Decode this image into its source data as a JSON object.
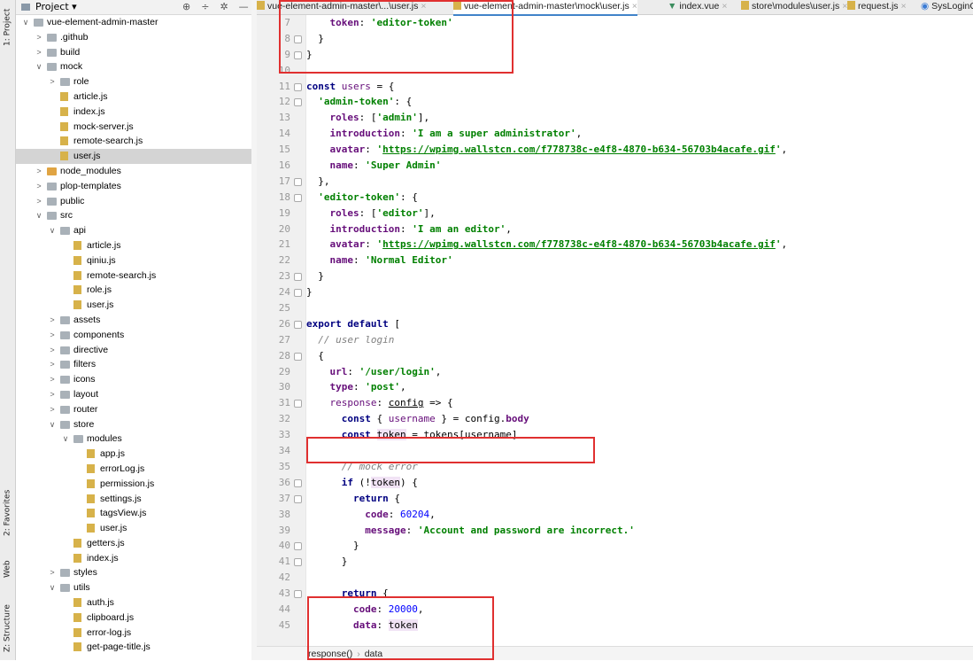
{
  "strip": {
    "project": "1: Project",
    "favorites": "2: Favorites",
    "web": "Web",
    "structure": "Z: Structure"
  },
  "project_header": {
    "label": "Project ▾",
    "tools": [
      "⊕",
      "÷",
      "✲",
      "—"
    ]
  },
  "tree": [
    {
      "depth": 0,
      "arrow": "∨",
      "type": "folder",
      "label": "vue-element-admin-master"
    },
    {
      "depth": 1,
      "arrow": ">",
      "type": "folder",
      "label": ".github"
    },
    {
      "depth": 1,
      "arrow": ">",
      "type": "folder",
      "label": "build"
    },
    {
      "depth": 1,
      "arrow": "∨",
      "type": "folder",
      "label": "mock"
    },
    {
      "depth": 2,
      "arrow": ">",
      "type": "folder",
      "label": "role"
    },
    {
      "depth": 2,
      "arrow": "",
      "type": "js",
      "label": "article.js"
    },
    {
      "depth": 2,
      "arrow": "",
      "type": "js",
      "label": "index.js"
    },
    {
      "depth": 2,
      "arrow": "",
      "type": "js",
      "label": "mock-server.js"
    },
    {
      "depth": 2,
      "arrow": "",
      "type": "js",
      "label": "remote-search.js"
    },
    {
      "depth": 2,
      "arrow": "",
      "type": "js",
      "label": "user.js",
      "selected": true
    },
    {
      "depth": 1,
      "arrow": ">",
      "type": "folder-orange",
      "label": "node_modules"
    },
    {
      "depth": 1,
      "arrow": ">",
      "type": "folder",
      "label": "plop-templates"
    },
    {
      "depth": 1,
      "arrow": ">",
      "type": "folder",
      "label": "public"
    },
    {
      "depth": 1,
      "arrow": "∨",
      "type": "folder",
      "label": "src"
    },
    {
      "depth": 2,
      "arrow": "∨",
      "type": "folder",
      "label": "api"
    },
    {
      "depth": 3,
      "arrow": "",
      "type": "js",
      "label": "article.js"
    },
    {
      "depth": 3,
      "arrow": "",
      "type": "js",
      "label": "qiniu.js"
    },
    {
      "depth": 3,
      "arrow": "",
      "type": "js",
      "label": "remote-search.js"
    },
    {
      "depth": 3,
      "arrow": "",
      "type": "js",
      "label": "role.js"
    },
    {
      "depth": 3,
      "arrow": "",
      "type": "js",
      "label": "user.js"
    },
    {
      "depth": 2,
      "arrow": ">",
      "type": "folder",
      "label": "assets"
    },
    {
      "depth": 2,
      "arrow": ">",
      "type": "folder",
      "label": "components"
    },
    {
      "depth": 2,
      "arrow": ">",
      "type": "folder",
      "label": "directive"
    },
    {
      "depth": 2,
      "arrow": ">",
      "type": "folder",
      "label": "filters"
    },
    {
      "depth": 2,
      "arrow": ">",
      "type": "folder",
      "label": "icons"
    },
    {
      "depth": 2,
      "arrow": ">",
      "type": "folder",
      "label": "layout"
    },
    {
      "depth": 2,
      "arrow": ">",
      "type": "folder",
      "label": "router"
    },
    {
      "depth": 2,
      "arrow": "∨",
      "type": "folder",
      "label": "store"
    },
    {
      "depth": 3,
      "arrow": "∨",
      "type": "folder",
      "label": "modules"
    },
    {
      "depth": 4,
      "arrow": "",
      "type": "js",
      "label": "app.js"
    },
    {
      "depth": 4,
      "arrow": "",
      "type": "js",
      "label": "errorLog.js"
    },
    {
      "depth": 4,
      "arrow": "",
      "type": "js",
      "label": "permission.js"
    },
    {
      "depth": 4,
      "arrow": "",
      "type": "js",
      "label": "settings.js"
    },
    {
      "depth": 4,
      "arrow": "",
      "type": "js",
      "label": "tagsView.js"
    },
    {
      "depth": 4,
      "arrow": "",
      "type": "js",
      "label": "user.js"
    },
    {
      "depth": 3,
      "arrow": "",
      "type": "js",
      "label": "getters.js"
    },
    {
      "depth": 3,
      "arrow": "",
      "type": "js",
      "label": "index.js"
    },
    {
      "depth": 2,
      "arrow": ">",
      "type": "folder",
      "label": "styles"
    },
    {
      "depth": 2,
      "arrow": "∨",
      "type": "folder",
      "label": "utils"
    },
    {
      "depth": 3,
      "arrow": "",
      "type": "js",
      "label": "auth.js"
    },
    {
      "depth": 3,
      "arrow": "",
      "type": "js",
      "label": "clipboard.js"
    },
    {
      "depth": 3,
      "arrow": "",
      "type": "js",
      "label": "error-log.js"
    },
    {
      "depth": 3,
      "arrow": "",
      "type": "js",
      "label": "get-page-title.js"
    }
  ],
  "tabs": [
    {
      "label": "vue-element-admin-master\\...\\user.js",
      "icon": "js",
      "close": "×"
    },
    {
      "label": "vue-element-admin-master\\mock\\user.js",
      "icon": "js",
      "close": "×",
      "active": true
    },
    {
      "label": "index.vue",
      "icon": "vue",
      "close": "×"
    },
    {
      "label": "store\\modules\\user.js",
      "icon": "js",
      "close": "×"
    },
    {
      "label": "request.js",
      "icon": "js",
      "close": "×"
    },
    {
      "label": "SysLoginC",
      "icon": "class",
      "close": ""
    }
  ],
  "code_lines": [
    {
      "n": "7",
      "fold": false,
      "html": "    <span class=\"p\">token</span>: <span class=\"s\">'editor-token'</span>"
    },
    {
      "n": "8",
      "fold": true,
      "html": "  }"
    },
    {
      "n": "9",
      "fold": true,
      "html": "}"
    },
    {
      "n": "10",
      "fold": false,
      "html": ""
    },
    {
      "n": "11",
      "fold": true,
      "html": "<span class=\"k\">const</span> <span class=\"v\">users</span> = {"
    },
    {
      "n": "12",
      "fold": true,
      "html": "  <span class=\"s\">'admin-token'</span>: {"
    },
    {
      "n": "13",
      "fold": false,
      "html": "    <span class=\"p\">roles</span>: [<span class=\"s\">'admin'</span>],"
    },
    {
      "n": "14",
      "fold": false,
      "html": "    <span class=\"p\">introduction</span>: <span class=\"s\">'I am a super administrator'</span>,"
    },
    {
      "n": "15",
      "fold": false,
      "html": "    <span class=\"p\">avatar</span>: <span class=\"s\">'<u>https://wpimg.wallstcn.com/f778738c-e4f8-4870-b634-56703b4acafe.gif</u>'</span>,"
    },
    {
      "n": "16",
      "fold": false,
      "html": "    <span class=\"p\">name</span>: <span class=\"s\">'Super Admin'</span>"
    },
    {
      "n": "17",
      "fold": true,
      "html": "  },"
    },
    {
      "n": "18",
      "fold": true,
      "html": "  <span class=\"s\">'editor-token'</span>: {"
    },
    {
      "n": "19",
      "fold": false,
      "html": "    <span class=\"p\">roles</span>: [<span class=\"s\">'editor'</span>],"
    },
    {
      "n": "20",
      "fold": false,
      "html": "    <span class=\"p\">introduction</span>: <span class=\"s\">'I am an editor'</span>,"
    },
    {
      "n": "21",
      "fold": false,
      "html": "    <span class=\"p\">avatar</span>: <span class=\"s\">'<u>https://wpimg.wallstcn.com/f778738c-e4f8-4870-b634-56703b4acafe.gif</u>'</span>,"
    },
    {
      "n": "22",
      "fold": false,
      "html": "    <span class=\"p\">name</span>: <span class=\"s\">'Normal Editor'</span>"
    },
    {
      "n": "23",
      "fold": true,
      "html": "  }"
    },
    {
      "n": "24",
      "fold": true,
      "html": "}"
    },
    {
      "n": "25",
      "fold": false,
      "html": ""
    },
    {
      "n": "26",
      "fold": true,
      "html": "<span class=\"k\">export default</span> ["
    },
    {
      "n": "27",
      "fold": false,
      "html": "  <span class=\"c\">// user login</span>"
    },
    {
      "n": "28",
      "fold": true,
      "html": "  {"
    },
    {
      "n": "29",
      "fold": false,
      "html": "    <span class=\"p\">url</span>: <span class=\"s\">'/user/login'</span>,"
    },
    {
      "n": "30",
      "fold": false,
      "html": "    <span class=\"p\">type</span>: <span class=\"s\">'post'</span>,"
    },
    {
      "n": "31",
      "fold": true,
      "html": "    <span class=\"v\">response</span>: <span class=\"u\">config</span> => {"
    },
    {
      "n": "32",
      "fold": false,
      "html": "      <span class=\"k\">const</span> { <span class=\"v\">username</span> } = config.<span class=\"p\">body</span>"
    },
    {
      "n": "33",
      "fold": false,
      "html": "      <span class=\"k\">const</span> <span class=\"hl\">token</span> = tokens[username]"
    },
    {
      "n": "34",
      "fold": false,
      "html": ""
    },
    {
      "n": "35",
      "fold": false,
      "html": "      <span class=\"c\">// mock error</span>"
    },
    {
      "n": "36",
      "fold": true,
      "html": "      <span class=\"k\">if</span> (!<span class=\"hl\">token</span>) {"
    },
    {
      "n": "37",
      "fold": true,
      "html": "        <span class=\"k\">return</span> {"
    },
    {
      "n": "38",
      "fold": false,
      "html": "          <span class=\"p\">code</span>: <span class=\"n\">60204</span>,"
    },
    {
      "n": "39",
      "fold": false,
      "html": "          <span class=\"p\">message</span>: <span class=\"s\">'Account and password are incorrect.'</span>"
    },
    {
      "n": "40",
      "fold": true,
      "html": "        }"
    },
    {
      "n": "41",
      "fold": true,
      "html": "      }"
    },
    {
      "n": "42",
      "fold": false,
      "html": ""
    },
    {
      "n": "43",
      "fold": true,
      "html": "      <span class=\"k\">return</span> {"
    },
    {
      "n": "44",
      "fold": false,
      "html": "        <span class=\"p\">code</span>: <span class=\"n\">20000</span>,"
    },
    {
      "n": "45",
      "fold": false,
      "html": "        <span class=\"p\">data</span>: <span class=\"hl\">token</span>"
    }
  ],
  "status": {
    "crumb1": "response()",
    "sep": "›",
    "crumb2": "data"
  },
  "highlight_color": "#e03030"
}
